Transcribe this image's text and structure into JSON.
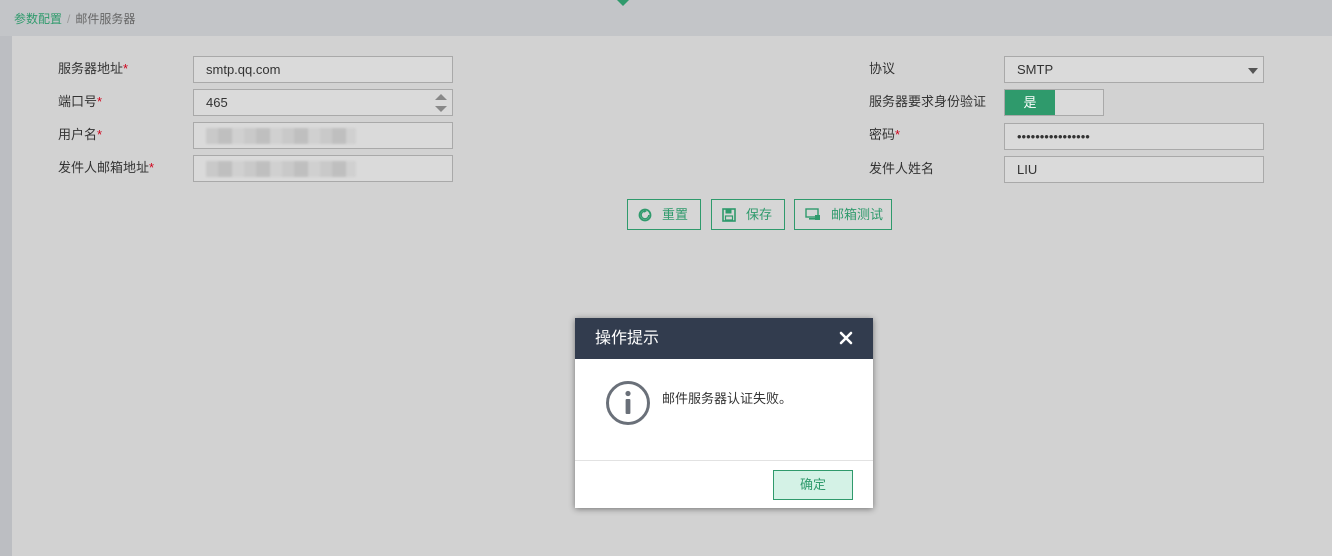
{
  "breadcrumb": {
    "parent": "参数配置",
    "separator": "/",
    "current": "邮件服务器"
  },
  "form": {
    "left": [
      {
        "label": "服务器地址",
        "required": "*",
        "value": "smtp.qq.com"
      },
      {
        "label": "端口号",
        "required": "*",
        "value": "465"
      },
      {
        "label": "用户名",
        "required": "*",
        "value": ""
      },
      {
        "label": "发件人邮箱地址",
        "required": "*",
        "value": ""
      }
    ],
    "right": [
      {
        "label": "协议",
        "required": "",
        "value": "SMTP"
      },
      {
        "label": "服务器要求身份验证",
        "required": "",
        "value": "是"
      },
      {
        "label": "密码",
        "required": "*",
        "value": "••••••••••••••••"
      },
      {
        "label": "发件人姓名",
        "required": "",
        "value": "LIU"
      }
    ]
  },
  "buttons": {
    "reset": "重置",
    "save": "保存",
    "test": "邮箱测试"
  },
  "dialog": {
    "title": "操作提示",
    "message": "邮件服务器认证失败。",
    "ok": "确定"
  },
  "colors": {
    "accent": "#2f9a6c",
    "dialog_header": "#323c4e",
    "required": "#d0021b",
    "panel": "#d2d2d2"
  },
  "icons": {
    "reset": "refresh-icon",
    "save": "floppy-icon",
    "test": "monitor-icon",
    "close": "close-icon",
    "info": "info-icon"
  }
}
